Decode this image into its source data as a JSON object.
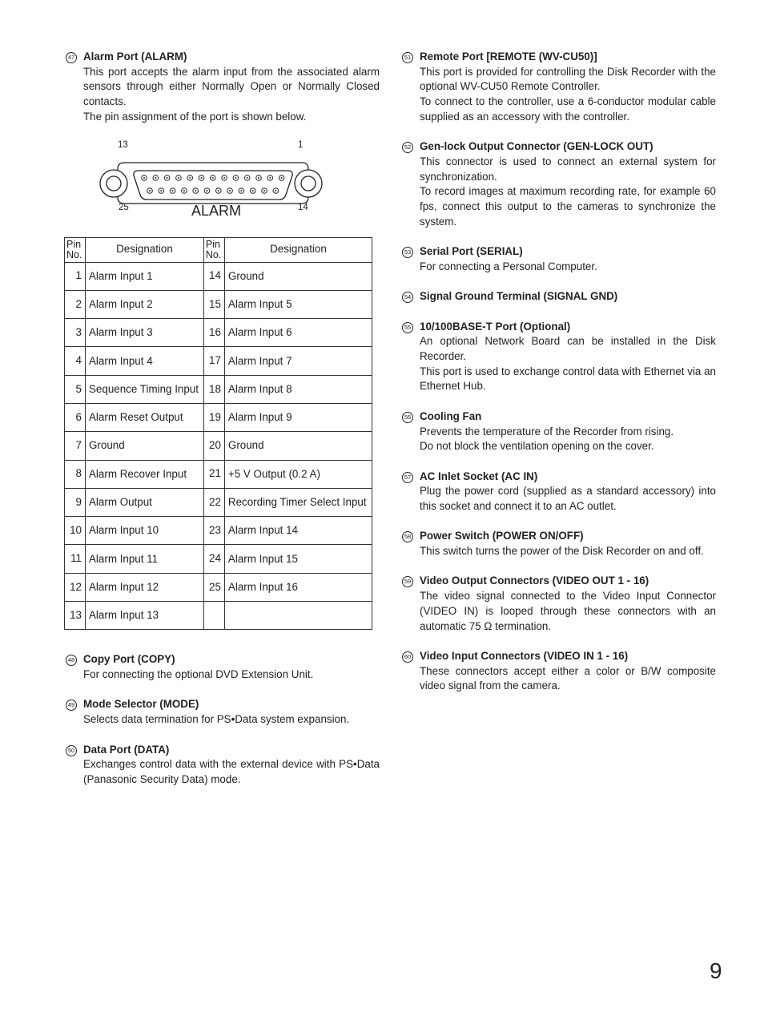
{
  "left_sections_top": [
    {
      "num": "47",
      "title": "Alarm Port (ALARM)",
      "paragraphs": [
        "This port accepts the alarm input from the associated alarm sensors through either Normally Open or Normally Closed contacts.",
        "The pin assignment of the port is shown below."
      ]
    }
  ],
  "diagram": {
    "label": "ALARM",
    "pin_top_left": "13",
    "pin_top_right": "1",
    "pin_bottom_left": "25",
    "pin_bottom_right": "14"
  },
  "table": {
    "headers": [
      "Pin No.",
      "Designation",
      "Pin No.",
      "Designation"
    ],
    "rows": [
      [
        "1",
        "Alarm Input 1",
        "14",
        "Ground"
      ],
      [
        "2",
        "Alarm Input 2",
        "15",
        "Alarm Input 5"
      ],
      [
        "3",
        "Alarm Input 3",
        "16",
        "Alarm Input 6"
      ],
      [
        "4",
        "Alarm Input 4",
        "17",
        "Alarm Input 7"
      ],
      [
        "5",
        "Sequence Timing Input",
        "18",
        "Alarm Input 8"
      ],
      [
        "6",
        "Alarm Reset Output",
        "19",
        "Alarm Input 9"
      ],
      [
        "7",
        "Ground",
        "20",
        "Ground"
      ],
      [
        "8",
        "Alarm Recover Input",
        "21",
        "+5 V Output (0.2 A)"
      ],
      [
        "9",
        "Alarm Output",
        "22",
        "Recording Timer Select Input"
      ],
      [
        "10",
        "Alarm Input 10",
        "23",
        "Alarm Input 14"
      ],
      [
        "11",
        "Alarm Input 11",
        "24",
        "Alarm Input 15"
      ],
      [
        "12",
        "Alarm Input 12",
        "25",
        "Alarm Input 16"
      ],
      [
        "13",
        "Alarm Input 13",
        "",
        ""
      ]
    ]
  },
  "left_sections_bottom": [
    {
      "num": "48",
      "title": "Copy Port (COPY)",
      "paragraphs": [
        "For connecting the optional DVD Extension Unit."
      ]
    },
    {
      "num": "49",
      "title": "Mode Selector (MODE)",
      "paragraphs": [
        "Selects data termination for PS•Data system expansion."
      ]
    },
    {
      "num": "50",
      "title": "Data Port (DATA)",
      "paragraphs": [
        "Exchanges control data with the external device with PS•Data (Panasonic Security Data) mode."
      ]
    }
  ],
  "right_sections": [
    {
      "num": "51",
      "title": "Remote Port [REMOTE (WV-CU50)]",
      "paragraphs": [
        "This port is provided for controlling the Disk Recorder with the optional WV-CU50 Remote Controller.",
        "To connect to the controller, use a 6-conductor modular cable supplied as an accessory with the controller."
      ]
    },
    {
      "num": "52",
      "title": "Gen-lock Output Connector (GEN-LOCK OUT)",
      "paragraphs": [
        "This connector is used to connect an external system for synchronization.",
        "To record images at maximum recording rate, for example 60 fps, connect this output to the cameras to synchronize the system."
      ]
    },
    {
      "num": "53",
      "title": "Serial Port (SERIAL)",
      "paragraphs": [
        "For connecting a Personal Computer."
      ]
    },
    {
      "num": "54",
      "title": "Signal Ground Terminal (SIGNAL GND)",
      "paragraphs": []
    },
    {
      "num": "55",
      "title": "10/100BASE-T Port (Optional)",
      "paragraphs": [
        "An optional Network Board can be installed in the Disk Recorder.",
        "This port is used to exchange control data with Ethernet via an Ethernet Hub."
      ]
    },
    {
      "num": "56",
      "title": "Cooling Fan",
      "paragraphs": [
        "Prevents the temperature of the Recorder from rising.",
        "Do not block the ventilation opening on the cover."
      ]
    },
    {
      "num": "57",
      "title": "AC Inlet Socket (AC IN)",
      "paragraphs": [
        "Plug the power cord (supplied as a standard accessory) into this socket and connect it to an AC outlet."
      ]
    },
    {
      "num": "58",
      "title": "Power Switch (POWER ON/OFF)",
      "paragraphs": [
        "This switch turns the power of the Disk Recorder on and off."
      ]
    },
    {
      "num": "59",
      "title": "Video Output Connectors (VIDEO OUT 1 - 16)",
      "paragraphs": [
        "The video signal connected to the Video Input Connector (VIDEO IN) is looped through these connectors with an automatic 75 Ω termination."
      ]
    },
    {
      "num": "60",
      "title": "Video Input Connectors (VIDEO IN 1 - 16)",
      "paragraphs": [
        "These connectors accept either a color or B/W composite video signal from the camera."
      ]
    }
  ],
  "page_number": "9"
}
